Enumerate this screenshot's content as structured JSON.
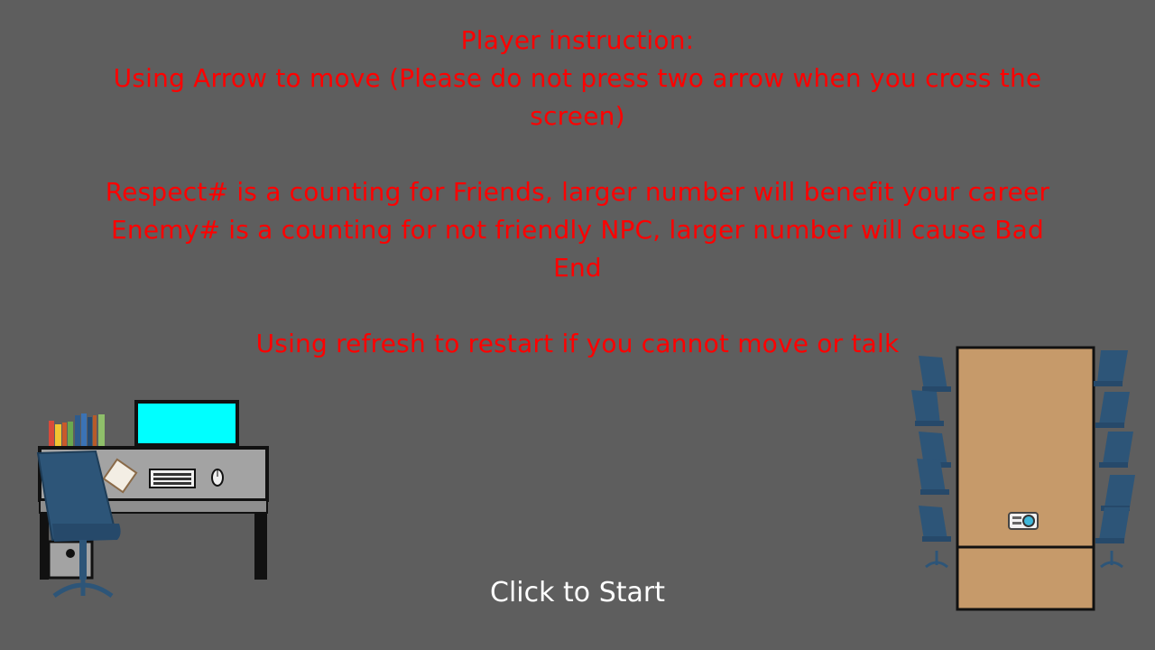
{
  "instructions": {
    "title": "Player instruction:",
    "move_line_1": "Using Arrow to move (Please do not press two arrow when you cross the",
    "move_line_2": "screen)",
    "respect_line": "Respect# is a counting for Friends, larger number will benefit your career",
    "enemy_line_1": "Enemy# is a counting for not friendly NPC, larger number will cause Bad",
    "enemy_line_2": "End",
    "refresh_line": "Using refresh to restart if you cannot move or talk"
  },
  "start": {
    "label": "Click to Start"
  },
  "colors": {
    "background": "#5e5e5e",
    "instruction_text": "#ff0000",
    "start_text": "#ffffff",
    "monitor_screen": "#00ffff",
    "desk_top": "#a3a3a3",
    "chair": "#2d5578",
    "conference_table": "#c69a6a"
  },
  "scene": {
    "left_prop": "office-desk-with-computer",
    "right_prop": "conference-table-with-chairs-and-projector"
  }
}
